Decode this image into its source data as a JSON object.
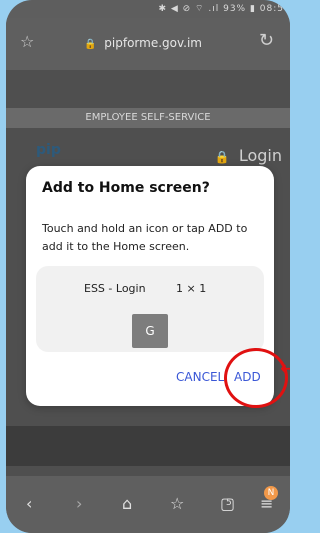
{
  "status_bar": {
    "icons_text": "✱ ◀ ⊘ ⌔ .ıl 93% ▮ 08:5"
  },
  "browser": {
    "url": "pipforme.gov.im",
    "star_icon": "star-icon",
    "reload_icon": "reload-icon",
    "lock_icon": "lock-icon"
  },
  "page": {
    "header": "EMPLOYEE SELF-SERVICE",
    "logo_text": "pip",
    "login_text": "Login"
  },
  "dialog": {
    "title": "Add to Home screen?",
    "description": "Touch and hold an icon or tap ADD to add it to the Home screen.",
    "shortcut_name": "ESS - Login",
    "shortcut_size": "1 × 1",
    "shortcut_icon_letter": "G",
    "cancel_label": "CANCEL",
    "add_label": "ADD"
  },
  "nav": {
    "back_icon": "back-icon",
    "forward_icon": "forward-icon",
    "home_icon": "home-icon",
    "bookmarks_icon": "bookmarks-icon",
    "tabs_icon": "tabs-icon",
    "tabs_count": "5",
    "menu_icon": "menu-icon",
    "badge": "N"
  }
}
